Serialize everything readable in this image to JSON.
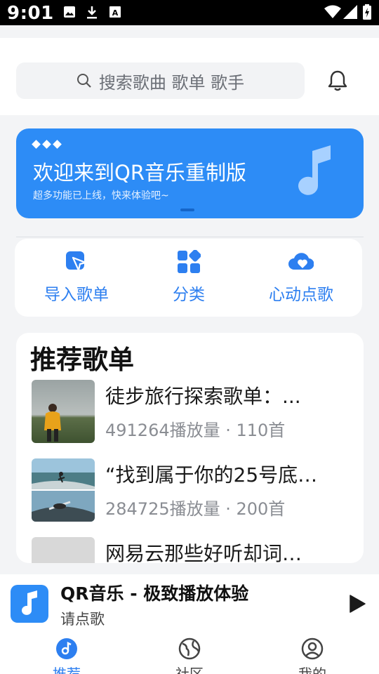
{
  "status_bar": {
    "time": "9:01",
    "icons": [
      "image-icon",
      "download-icon",
      "font-icon",
      "wifi-icon",
      "signal-icon",
      "battery-charging-icon"
    ]
  },
  "search": {
    "placeholder": "搜索歌曲 歌单 歌手"
  },
  "banner": {
    "title": "欢迎来到QR音乐重制版",
    "subtitle": "超多功能已上线，快来体验吧~",
    "color": "#2d8cf6"
  },
  "shortcuts": [
    {
      "label": "导入歌单",
      "icon": "import-cursor-icon"
    },
    {
      "label": "分类",
      "icon": "category-grid-icon"
    },
    {
      "label": "心动点歌",
      "icon": "heart-cloud-icon"
    }
  ],
  "recommend": {
    "title": "推荐歌单",
    "items": [
      {
        "name": "徒步旅行探索歌单：...",
        "meta": "491264播放量 · 110首"
      },
      {
        "name": "“找到属于你的25号底…",
        "meta": "284725播放量 · 200首"
      },
      {
        "name": "网易云那些好听却词…",
        "meta": ""
      }
    ]
  },
  "player": {
    "title": "QR音乐 - 极致播放体验",
    "subtitle": "请点歌"
  },
  "nav": [
    {
      "label": "推荐",
      "icon": "music-disc-icon",
      "active": true
    },
    {
      "label": "社区",
      "icon": "globe-icon",
      "active": false
    },
    {
      "label": "我的",
      "icon": "user-icon",
      "active": false
    }
  ],
  "colors": {
    "accent": "#2d7ff0",
    "banner": "#2d8cf6",
    "background": "#f3f4f6"
  }
}
